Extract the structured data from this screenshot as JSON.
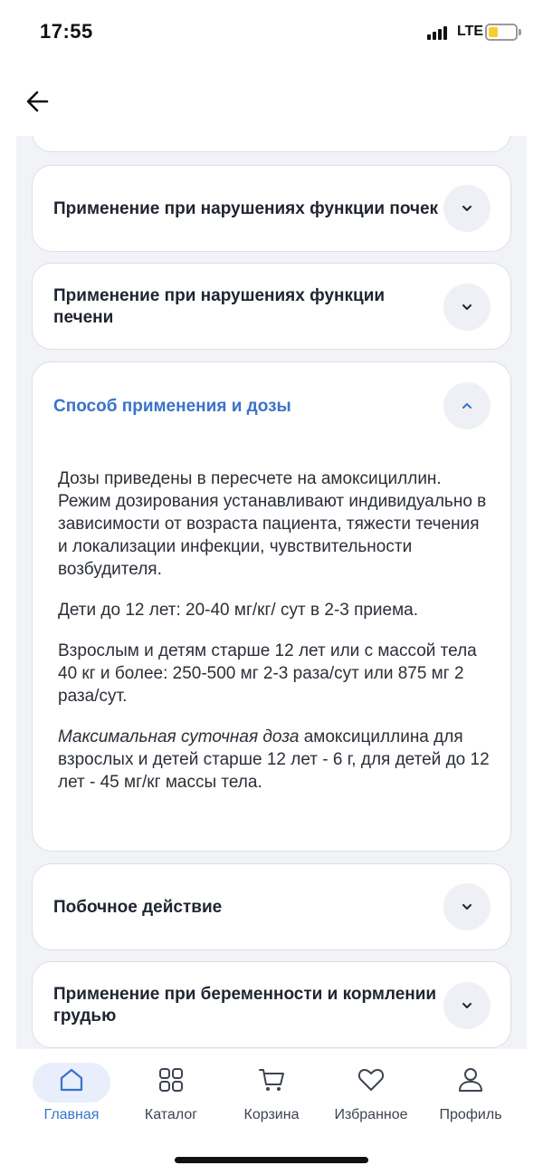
{
  "status_bar": {
    "time": "17:55",
    "network": "LTE",
    "battery_color": "#f6cf2c"
  },
  "header": {
    "back_icon": "arrow-left-icon"
  },
  "accordion": {
    "kidney": {
      "title": "Применение при нарушениях функции почек",
      "expanded": false
    },
    "liver": {
      "title_line1": "Применение при нарушениях функции",
      "title_line2": "печени",
      "expanded": false
    },
    "dosage": {
      "title": "Способ применения и дозы",
      "expanded": true,
      "paragraphs": [
        "Дозы приведены в пересчете на амоксициллин. Режим дозирования устанавливают индивидуально в зависимости от возраста пациента, тяжести течения и локализации инфекции, чувствительности возбудителя.",
        "Дети до 12 лет: 20-40 мг/кг/ сут в 2-3 приема.",
        "Взрослым и детям старше 12 лет или с массой тела 40 кг и более: 250-500 мг 2-3 раза/сут или 875 мг 2 раза/сут."
      ],
      "max_dose_italic": "Максимальная суточная доза",
      "max_dose_rest": " амоксициллина для взрослых и детей старше 12 лет - 6 г, для детей до 12 лет - 45 мг/кг массы тела."
    },
    "side_effects": {
      "title": "Побочное действие",
      "expanded": false
    },
    "pregnancy": {
      "title_line1": "Применение при беременности и кормлении",
      "title_line2": "грудью",
      "expanded": false
    }
  },
  "tabbar": {
    "active_color": "#3a73c9",
    "tabs": [
      {
        "label": "Главная",
        "icon": "home-icon"
      },
      {
        "label": "Каталог",
        "icon": "grid-icon"
      },
      {
        "label": "Корзина",
        "icon": "cart-icon"
      },
      {
        "label": "Избранное",
        "icon": "heart-icon"
      },
      {
        "label": "Профиль",
        "icon": "user-icon"
      }
    ]
  }
}
